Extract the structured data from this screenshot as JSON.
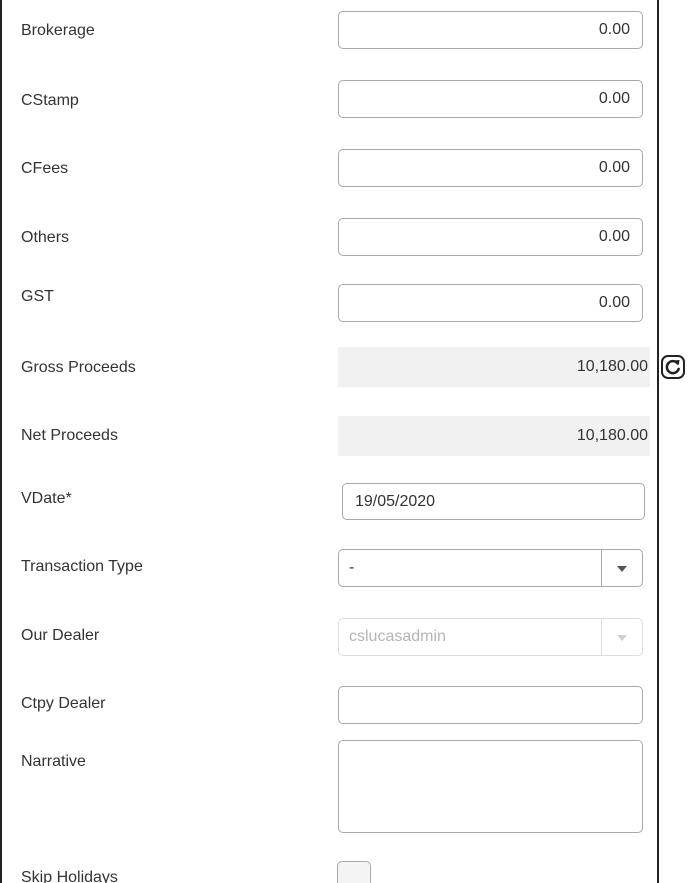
{
  "form": {
    "brokerage": {
      "label": "Brokerage",
      "value": "0.00"
    },
    "cstamp": {
      "label": "CStamp",
      "value": "0.00"
    },
    "cfees": {
      "label": "CFees",
      "value": "0.00"
    },
    "others": {
      "label": "Others",
      "value": "0.00"
    },
    "gst": {
      "label": "GST",
      "value": "0.00"
    },
    "gross_proceeds": {
      "label": "Gross Proceeds",
      "value": "10,180.00"
    },
    "net_proceeds": {
      "label": "Net Proceeds",
      "value": "10,180.00"
    },
    "vdate": {
      "label": "VDate*",
      "value": "19/05/2020"
    },
    "transaction_type": {
      "label": "Transaction Type",
      "value": "-"
    },
    "our_dealer": {
      "label": "Our Dealer",
      "value": "cslucasadmin"
    },
    "ctpy_dealer": {
      "label": "Ctpy Dealer",
      "value": ""
    },
    "narrative": {
      "label": "Narrative",
      "value": ""
    },
    "skip_holidays": {
      "label": "Skip Holidays",
      "checked": false
    }
  },
  "icons": {
    "refresh": "refresh-icon",
    "dropdown": "chevron-down-icon"
  }
}
